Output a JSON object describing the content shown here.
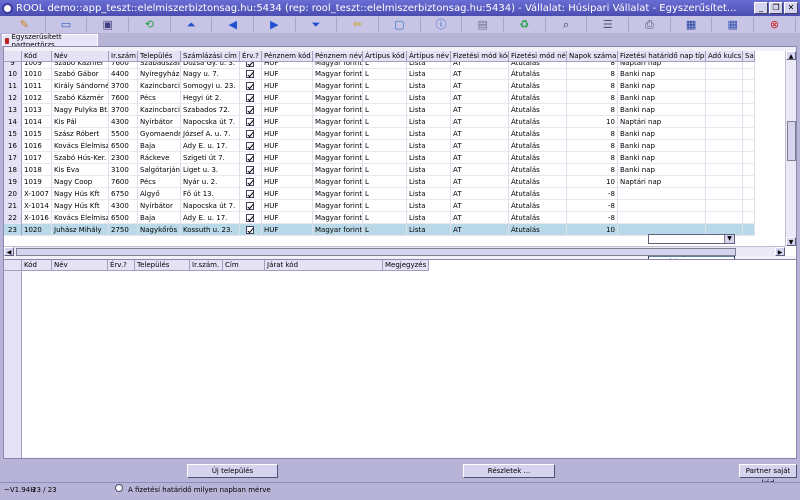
{
  "window": {
    "title": "ROOL demo::app_teszt::elelmiszerbiztonsag.hu:5434 (rep: rool_teszt::elelmiszerbiztonsag.hu:5434) - Vállalat: Húsipari Vállalat - Egyszerűsítet...",
    "min_label": "_",
    "restore_label": "❐",
    "close_label": "✕"
  },
  "toolbar": {
    "icons": [
      {
        "name": "edit-icon",
        "glyph": "✎",
        "color": "#d08020"
      },
      {
        "name": "open-icon",
        "glyph": "▭",
        "color": "#3060c0"
      },
      {
        "name": "save-icon",
        "glyph": "▣",
        "color": "#404080"
      },
      {
        "name": "refresh-icon",
        "glyph": "⟲",
        "color": "#20a040"
      },
      {
        "name": "first-record-icon",
        "glyph": "⏶",
        "color": "#2050d0"
      },
      {
        "name": "prev-record-icon",
        "glyph": "◀",
        "color": "#2050d0"
      },
      {
        "name": "next-record-icon",
        "glyph": "▶",
        "color": "#2050d0"
      },
      {
        "name": "last-record-icon",
        "glyph": "⏷",
        "color": "#2050d0"
      },
      {
        "name": "pencil-icon",
        "glyph": "✏",
        "color": "#d0a020"
      },
      {
        "name": "new-window-icon",
        "glyph": "▢",
        "color": "#3070c0"
      },
      {
        "name": "info-icon",
        "glyph": "ⓘ",
        "color": "#2060d0"
      },
      {
        "name": "form-icon",
        "glyph": "▤",
        "color": "#707090"
      },
      {
        "name": "recycle-icon",
        "glyph": "♻",
        "color": "#20a040"
      },
      {
        "name": "search-icon",
        "glyph": "⌕",
        "color": "#404060"
      },
      {
        "name": "list-icon",
        "glyph": "☰",
        "color": "#505070"
      },
      {
        "name": "print-icon",
        "glyph": "⎙",
        "color": "#505070"
      },
      {
        "name": "table-icon",
        "glyph": "▦",
        "color": "#2040a0"
      },
      {
        "name": "grid-icon",
        "glyph": "▦",
        "color": "#3050b0"
      },
      {
        "name": "exit-icon",
        "glyph": "⊗",
        "color": "#d02020"
      }
    ]
  },
  "tab": {
    "label": "Egyszerűsített partnertörzs"
  },
  "grid": {
    "columns": [
      "Kód",
      "Név",
      "Ir.szám",
      "Település",
      "Számlázási cím",
      "Érv.?",
      "Pénznem kód",
      "Pénznem név",
      "Ártípus kód",
      "Ártípus név",
      "Fizetési mód kód",
      "Fizetési mód név",
      "Napok száma",
      "Fizetési határidő nap típus",
      "Adó kulcs",
      "Sa"
    ],
    "partial_row": {
      "rn": "9",
      "kod": "1009",
      "nev": "Szabó Kázmér",
      "irsz": "7600",
      "telep": "Szabadszállás",
      "cim": "Dózsa Gy. u. 3.",
      "pkod": "HUF",
      "pnev": "Magyar forint",
      "akod": "L",
      "anev": "Lista",
      "fkod": "AT",
      "fnev": "Átutalás",
      "napok": "8",
      "tipus": "Naptári nap"
    },
    "rows": [
      {
        "rn": "10",
        "kod": "1010",
        "nev": "Szabó Gábor",
        "irsz": "4400",
        "telep": "Nyíregyháza",
        "cim": "Nagy u. 7.",
        "pkod": "HUF",
        "pnev": "Magyar forint",
        "akod": "L",
        "anev": "Lista",
        "fkod": "AT",
        "fnev": "Átutalás",
        "napok": "8",
        "tipus": "Banki nap"
      },
      {
        "rn": "11",
        "kod": "1011",
        "nev": "Király Sándorné",
        "irsz": "3700",
        "telep": "Kazincbarcika",
        "cim": "Somogyi u. 23.",
        "pkod": "HUF",
        "pnev": "Magyar forint",
        "akod": "L",
        "anev": "Lista",
        "fkod": "AT",
        "fnev": "Átutalás",
        "napok": "8",
        "tipus": "Banki nap"
      },
      {
        "rn": "12",
        "kod": "1012",
        "nev": "Szabó Kázmér",
        "irsz": "7600",
        "telep": "Pécs",
        "cim": "Hegyi út 2.",
        "pkod": "HUF",
        "pnev": "Magyar forint",
        "akod": "L",
        "anev": "Lista",
        "fkod": "AT",
        "fnev": "Átutalás",
        "napok": "8",
        "tipus": "Banki nap"
      },
      {
        "rn": "13",
        "kod": "1013",
        "nev": "Nagy Pulyka Bt.",
        "irsz": "3700",
        "telep": "Kazincbarcika",
        "cim": "Szabados 72.",
        "pkod": "HUF",
        "pnev": "Magyar forint",
        "akod": "L",
        "anev": "Lista",
        "fkod": "AT",
        "fnev": "Átutalás",
        "napok": "8",
        "tipus": "Banki nap"
      },
      {
        "rn": "14",
        "kod": "1014",
        "nev": "Kis Pál",
        "irsz": "4300",
        "telep": "Nyírbátor",
        "cim": "Napocska út 7.",
        "pkod": "HUF",
        "pnev": "Magyar forint",
        "akod": "L",
        "anev": "Lista",
        "fkod": "AT",
        "fnev": "Átutalás",
        "napok": "10",
        "tipus": "Naptári nap"
      },
      {
        "rn": "15",
        "kod": "1015",
        "nev": "Szász Róbert",
        "irsz": "5500",
        "telep": "Gyomaendrőd",
        "cim": "József A. u. 7.",
        "pkod": "HUF",
        "pnev": "Magyar forint",
        "akod": "L",
        "anev": "Lista",
        "fkod": "AT",
        "fnev": "Átutalás",
        "napok": "8",
        "tipus": "Banki nap"
      },
      {
        "rn": "16",
        "kod": "1016",
        "nev": "Kovács Élelmiszer Kft.",
        "irsz": "6500",
        "telep": "Baja",
        "cim": "Ady E. u. 17.",
        "pkod": "HUF",
        "pnev": "Magyar forint",
        "akod": "L",
        "anev": "Lista",
        "fkod": "AT",
        "fnev": "Átutalás",
        "napok": "8",
        "tipus": "Banki nap"
      },
      {
        "rn": "17",
        "kod": "1017",
        "nev": "Szabó Hús-Ker.",
        "irsz": "2300",
        "telep": "Ráckeve",
        "cim": "Szigeti út 7.",
        "pkod": "HUF",
        "pnev": "Magyar forint",
        "akod": "L",
        "anev": "Lista",
        "fkod": "AT",
        "fnev": "Átutalás",
        "napok": "8",
        "tipus": "Banki nap"
      },
      {
        "rn": "18",
        "kod": "1018",
        "nev": "Kis Éva",
        "irsz": "3100",
        "telep": "Salgótarján",
        "cim": "Liget u. 3.",
        "pkod": "HUF",
        "pnev": "Magyar forint",
        "akod": "L",
        "anev": "Lista",
        "fkod": "AT",
        "fnev": "Átutalás",
        "napok": "8",
        "tipus": "Banki nap"
      },
      {
        "rn": "19",
        "kod": "1019",
        "nev": "Nagy Coop",
        "irsz": "7600",
        "telep": "Pécs",
        "cim": "Nyár u. 2.",
        "pkod": "HUF",
        "pnev": "Magyar forint",
        "akod": "L",
        "anev": "Lista",
        "fkod": "AT",
        "fnev": "Átutalás",
        "napok": "10",
        "tipus": "Naptári nap"
      },
      {
        "rn": "20",
        "kod": "X-1007",
        "nev": "Nagy Hús Kft",
        "irsz": "6750",
        "telep": "Algyő",
        "cim": "Fő út 13.",
        "pkod": "HUF",
        "pnev": "Magyar forint",
        "akod": "L",
        "anev": "Lista",
        "fkod": "AT",
        "fnev": "Átutalás",
        "napok": "-8",
        "tipus": ""
      },
      {
        "rn": "21",
        "kod": "X-1014",
        "nev": "Nagy Hús Kft",
        "irsz": "4300",
        "telep": "Nyírbátor",
        "cim": "Napocska út 7.",
        "pkod": "HUF",
        "pnev": "Magyar forint",
        "akod": "L",
        "anev": "Lista",
        "fkod": "AT",
        "fnev": "Átutalás",
        "napok": "-8",
        "tipus": ""
      },
      {
        "rn": "22",
        "kod": "X-1016",
        "nev": "Kovács Élelmiszer Kft.",
        "irsz": "6500",
        "telep": "Baja",
        "cim": "Ady E. u. 17.",
        "pkod": "HUF",
        "pnev": "Magyar forint",
        "akod": "L",
        "anev": "Lista",
        "fkod": "AT",
        "fnev": "Átutalás",
        "napok": "-8",
        "tipus": ""
      },
      {
        "rn": "23",
        "kod": "1020",
        "nev": "Juhász Mihály",
        "irsz": "2750",
        "telep": "Nagykőrös",
        "cim": "Kossuth u. 23.",
        "pkod": "HUF",
        "pnev": "Magyar forint",
        "akod": "L",
        "anev": "Lista",
        "fkod": "AT",
        "fnev": "Átutalás",
        "napok": "10",
        "tipus": "",
        "selected": true
      }
    ],
    "dropdown_options": [
      "Banki nap",
      "Naptári nap"
    ],
    "dropdown_selected": "Banki nap"
  },
  "subgrid": {
    "columns": [
      "Kód",
      "Név",
      "Érv.?",
      "Település",
      "Ir.szám.",
      "Cím",
      "Járat kód",
      "Megjegyzés"
    ]
  },
  "buttons": {
    "new_settlement": "Új település",
    "details": "Részletek ...",
    "partner_own_code": "Partner saját kód"
  },
  "status": {
    "version": "~V1.94H",
    "record": "23 / 23",
    "hint": "A fizetési határidő milyen napban mérve"
  }
}
